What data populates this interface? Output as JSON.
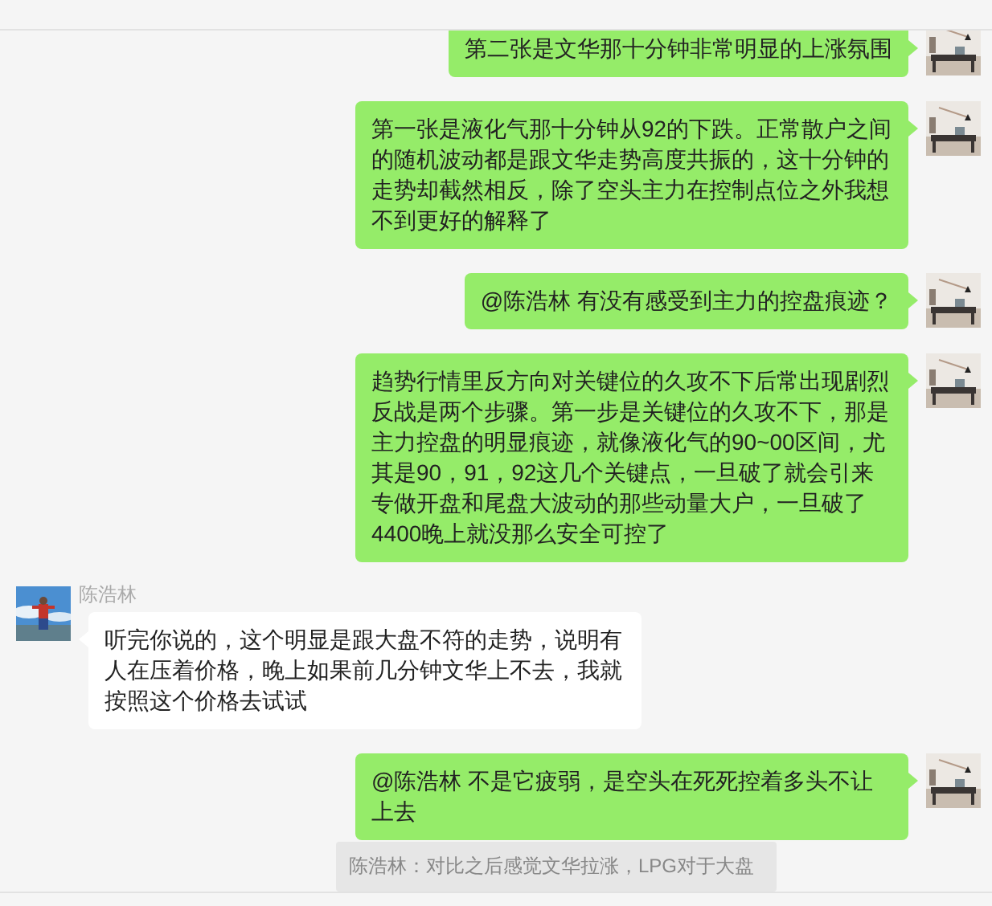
{
  "messages": [
    {
      "kind": "outgoing",
      "text": "第二张是文华那十分钟非常明显的上涨氛围"
    },
    {
      "kind": "outgoing",
      "text": "第一张是液化气那十分钟从92的下跌。正常散户之间的随机波动都是跟文华走势高度共振的，这十分钟的走势却截然相反，除了空头主力在控制点位之外我想不到更好的解释了"
    },
    {
      "kind": "outgoing",
      "text": "@陈浩林 有没有感受到主力的控盘痕迹？"
    },
    {
      "kind": "outgoing",
      "text": "趋势行情里反方向对关键位的久攻不下后常出现剧烈反战是两个步骤。第一步是关键位的久攻不下，那是主力控盘的明显痕迹，就像液化气的90~00区间，尤其是90，91，92这几个关键点，一旦破了就会引来专做开盘和尾盘大波动的那些动量大户，一旦破了4400晚上就没那么安全可控了"
    },
    {
      "kind": "incoming",
      "sender": "陈浩林",
      "text": "听完你说的，这个明显是跟大盘不符的走势，说明有人在压着价格，晚上如果前几分钟文华上不去，我就按照这个价格去试试"
    },
    {
      "kind": "outgoing",
      "text": "@陈浩林 不是它疲弱，是空头在死死控着多头不让上去"
    }
  ],
  "quote": {
    "text": "陈浩林：对比之后感觉文华拉涨，LPG对于大盘"
  }
}
